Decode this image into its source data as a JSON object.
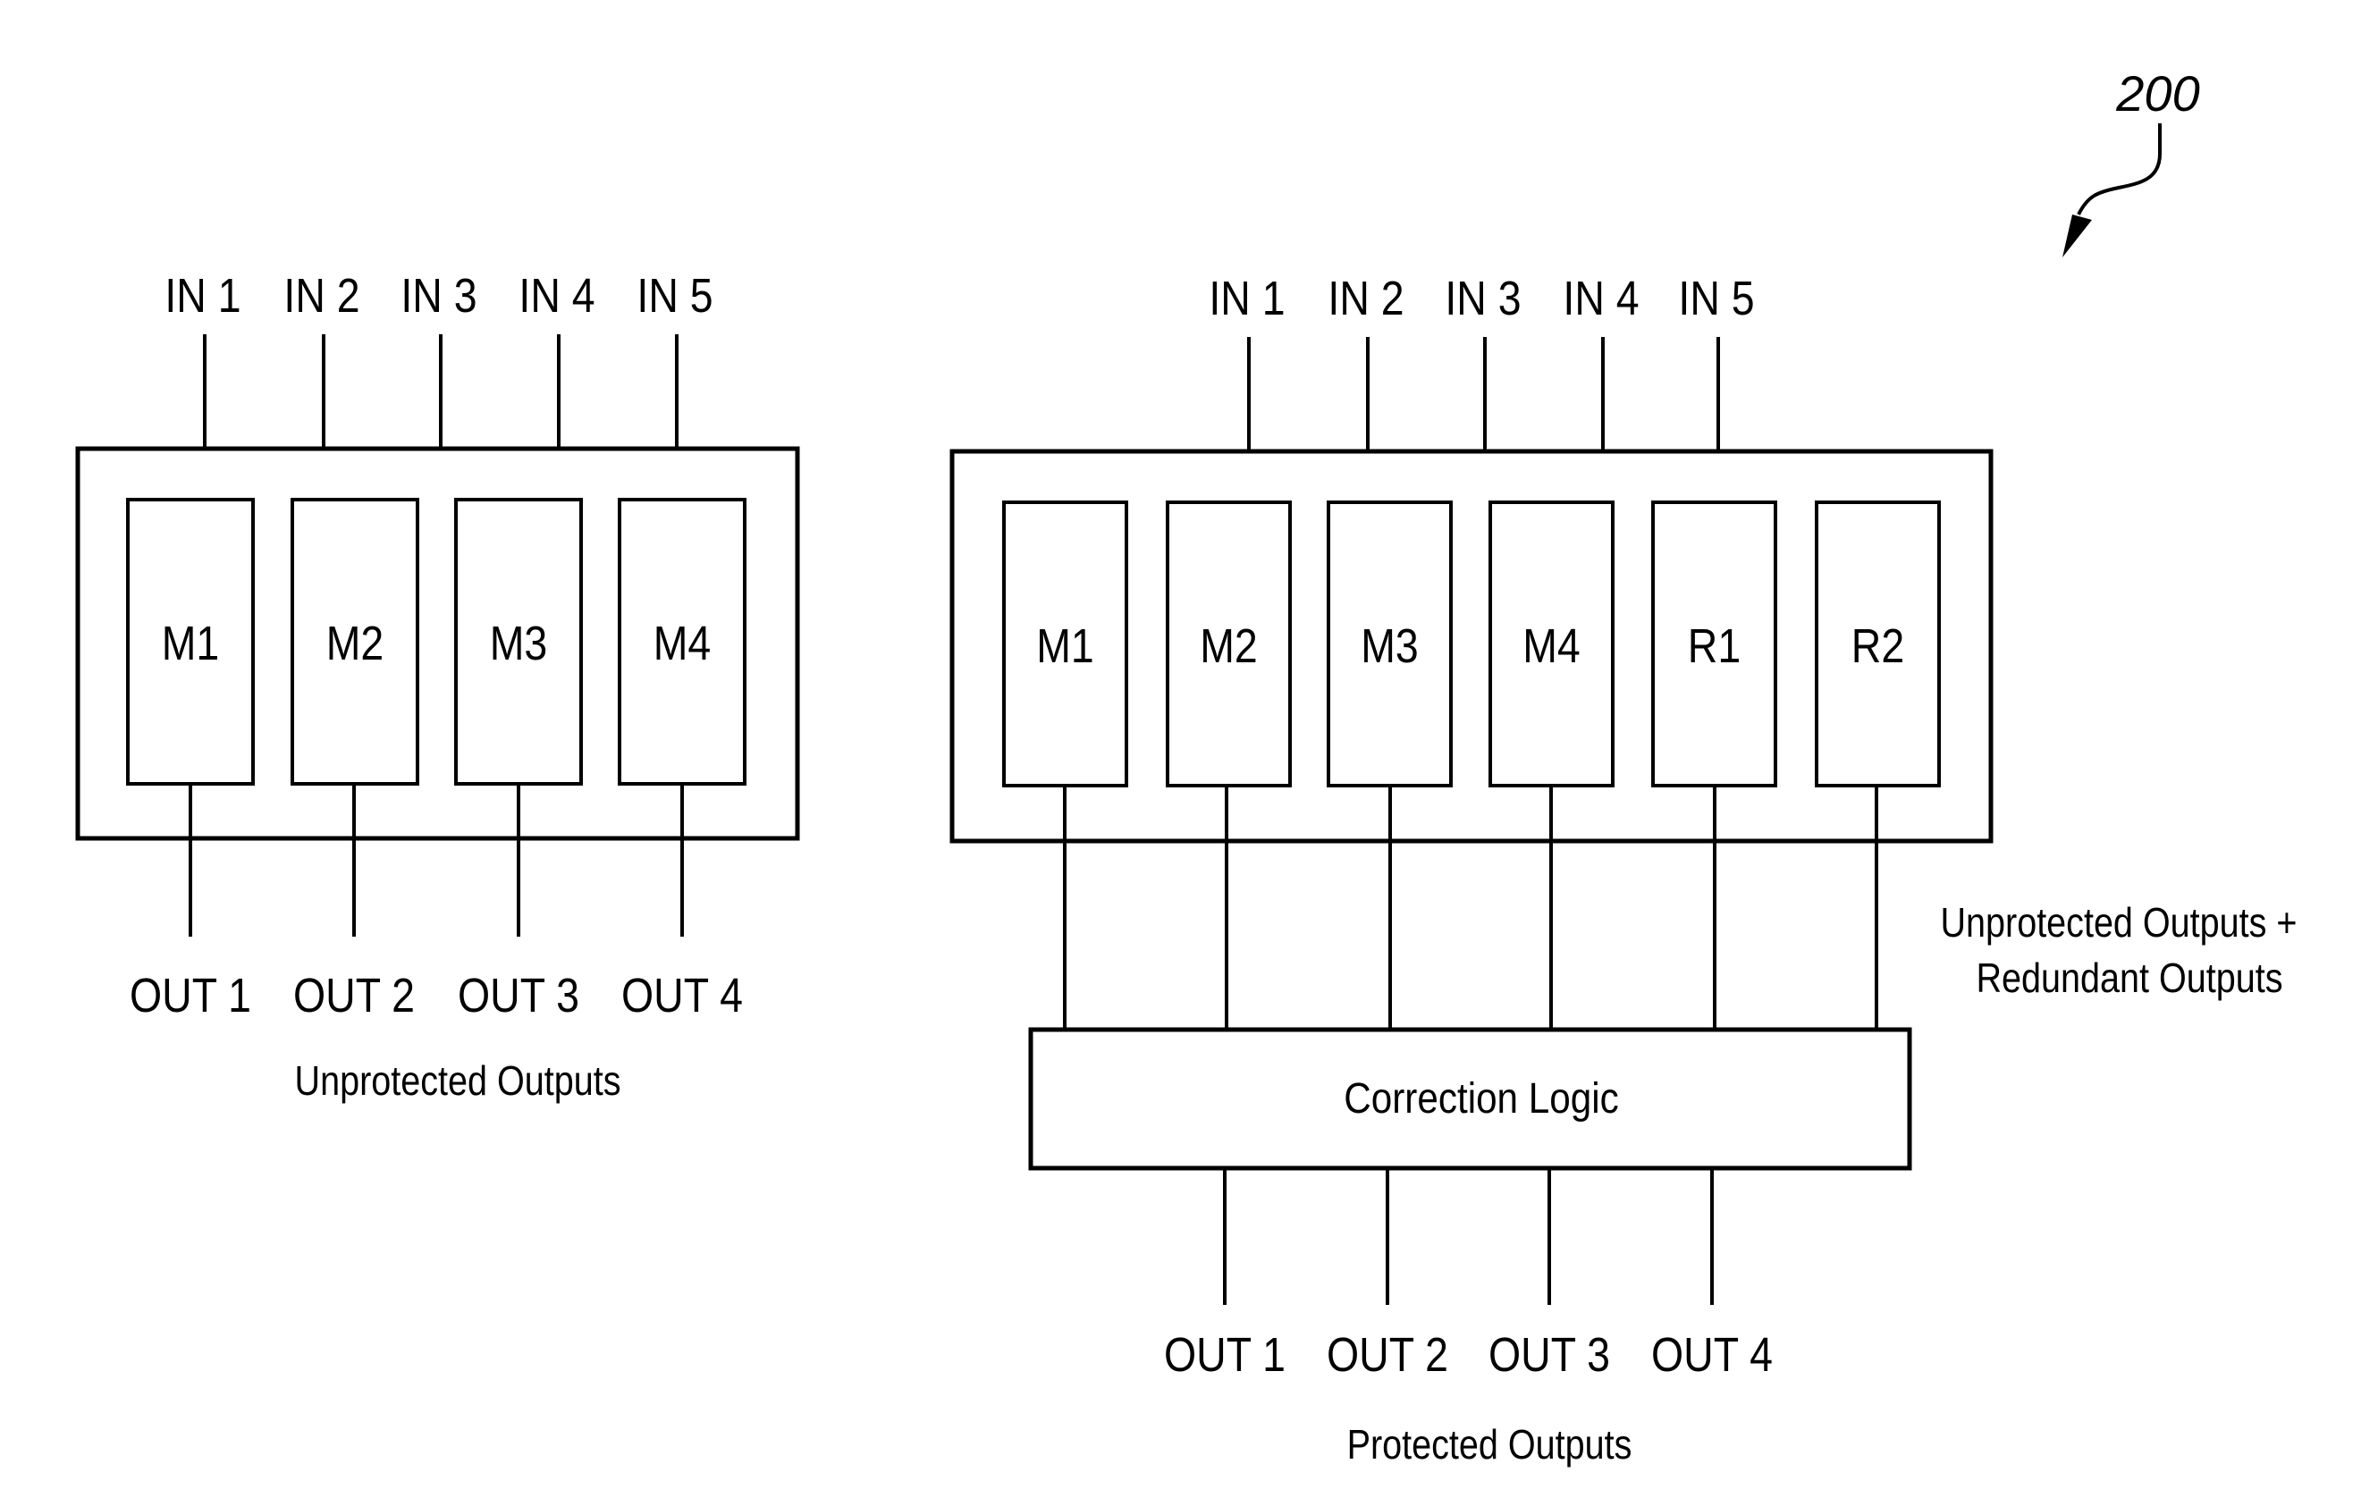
{
  "figure": {
    "reference_numeral": "200",
    "colors": {
      "ink": "#000000",
      "background": "#ffffff"
    }
  },
  "unprotected_system": {
    "inputs": [
      "IN 1",
      "IN 2",
      "IN 3",
      "IN 4",
      "IN 5"
    ],
    "modules": [
      "M1",
      "M2",
      "M3",
      "M4"
    ],
    "outputs": [
      "OUT 1",
      "OUT 2",
      "OUT 3",
      "OUT 4"
    ],
    "caption": "Unprotected Outputs"
  },
  "protected_system": {
    "inputs": [
      "IN 1",
      "IN 2",
      "IN 3",
      "IN 4",
      "IN 5"
    ],
    "modules": [
      "M1",
      "M2",
      "M3",
      "M4",
      "R1",
      "R2"
    ],
    "intermediate_caption_line1": "Unprotected Outputs +",
    "intermediate_caption_line2": "Redundant Outputs",
    "correction_block": "Correction Logic",
    "outputs": [
      "OUT 1",
      "OUT 2",
      "OUT 3",
      "OUT 4"
    ],
    "caption": "Protected Outputs"
  }
}
